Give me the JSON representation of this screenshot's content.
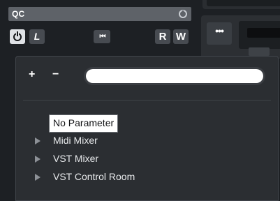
{
  "channel": {
    "title": "QC",
    "record_icon": "record-ring-icon"
  },
  "controls": {
    "power_icon": "power-icon",
    "link_label": "L",
    "jump_icon": "skip-back-icon",
    "jump_label": "⏮",
    "read_label": "R",
    "write_label": "W"
  },
  "right_panel": {
    "more_label": "•••"
  },
  "popup": {
    "add_label": "+",
    "remove_label": "−",
    "search_value": "",
    "tooltip": "No Parameter",
    "tree": [
      {
        "label": "Midi Mixer",
        "icon": "expand-arrow-icon"
      },
      {
        "label": "VST Mixer",
        "icon": "expand-arrow-icon"
      },
      {
        "label": "VST Control Room",
        "icon": "expand-arrow-icon"
      }
    ]
  },
  "colors": {
    "background": "#1d2024",
    "header": "#5e6268",
    "popup": "#2b2e32",
    "button": "#474b51"
  }
}
